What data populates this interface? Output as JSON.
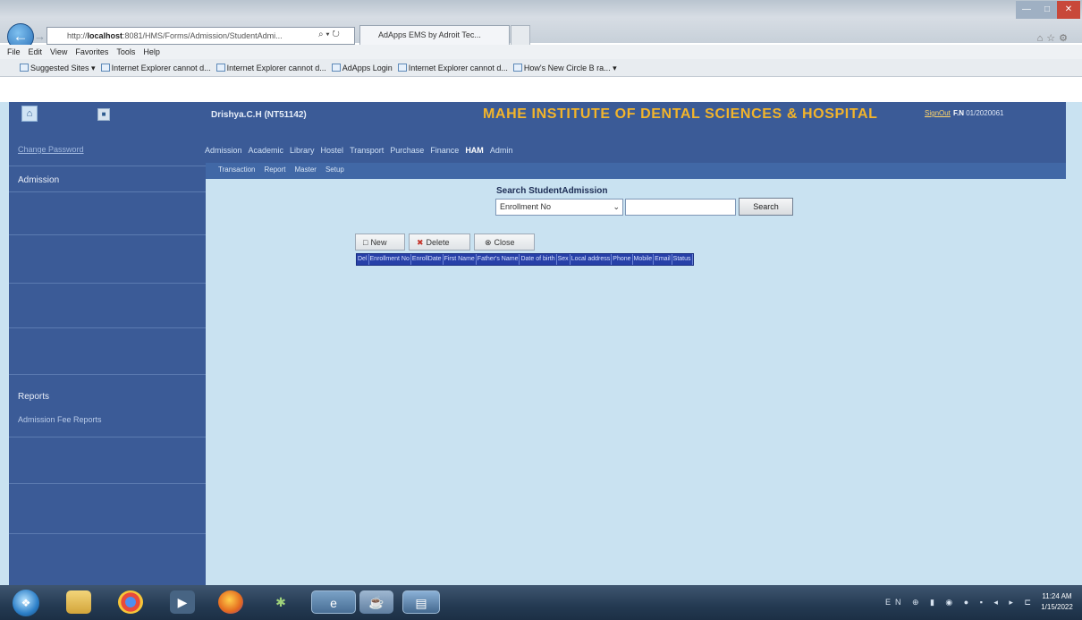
{
  "browser": {
    "address_prefix": "http://",
    "address_host": "localhost",
    "address_rest": ":8081/HMS/Forms/Admission/StudentAdmi...",
    "address_controls": "⌕ ▾ ↻",
    "tab_label": "AdApps EMS by Adroit Tec...",
    "menu": [
      "File",
      "Edit",
      "View",
      "Favorites",
      "Tools",
      "Help"
    ],
    "favorites": [
      "Suggested Sites ▾",
      "Internet Explorer cannot d...",
      "Internet Explorer cannot d...",
      "AdApps Login",
      "Internet Explorer cannot d...",
      "How's New Circle B ra... ▾"
    ]
  },
  "sidebar": {
    "change_password": "Change Password",
    "admission": "Admission",
    "reports": "Reports",
    "admission_fee_reports": "Admission Fee Reports"
  },
  "header": {
    "user": "Drishya.C.H (NT51142)",
    "institute": "MAHE INSTITUTE OF DENTAL SCIENCES & HOSPITAL",
    "signout": "SignOut",
    "fn": "F.N",
    "fn_value": "01/2020061"
  },
  "nav": {
    "items": [
      "Admission",
      "Academic",
      "Library",
      "Hostel",
      "Transport",
      "Purchase",
      "Finance",
      "HAM",
      "Admin"
    ],
    "active": "HAM"
  },
  "subnav": [
    "Transaction",
    "Report",
    "Master",
    "Setup"
  ],
  "search": {
    "title": "Search StudentAdmission",
    "selected_field": "Enrollment No",
    "input_value": "",
    "button": "Search"
  },
  "toolbar": {
    "new": "New",
    "delete": "Delete",
    "close": "Close"
  },
  "grid": {
    "columns": [
      "Del",
      "Enrollment No",
      "EnrollDate",
      "First Name",
      "Father's Name",
      "Date of birth",
      "Sex",
      "Local address",
      "Phone",
      "Mobile",
      "Email",
      "Status"
    ]
  },
  "taskbar": {
    "tray": "EN ⊕ ▮ ◉ ● ▪ ◂ ▸ ⊏",
    "time": "11:24 AM",
    "date": "1/15/2022"
  },
  "colors": {
    "page_bg": "#c9e2f1",
    "nav_bg": "#3b5b97",
    "title_accent": "#f2b42b",
    "grid_header": "#2740a8"
  }
}
